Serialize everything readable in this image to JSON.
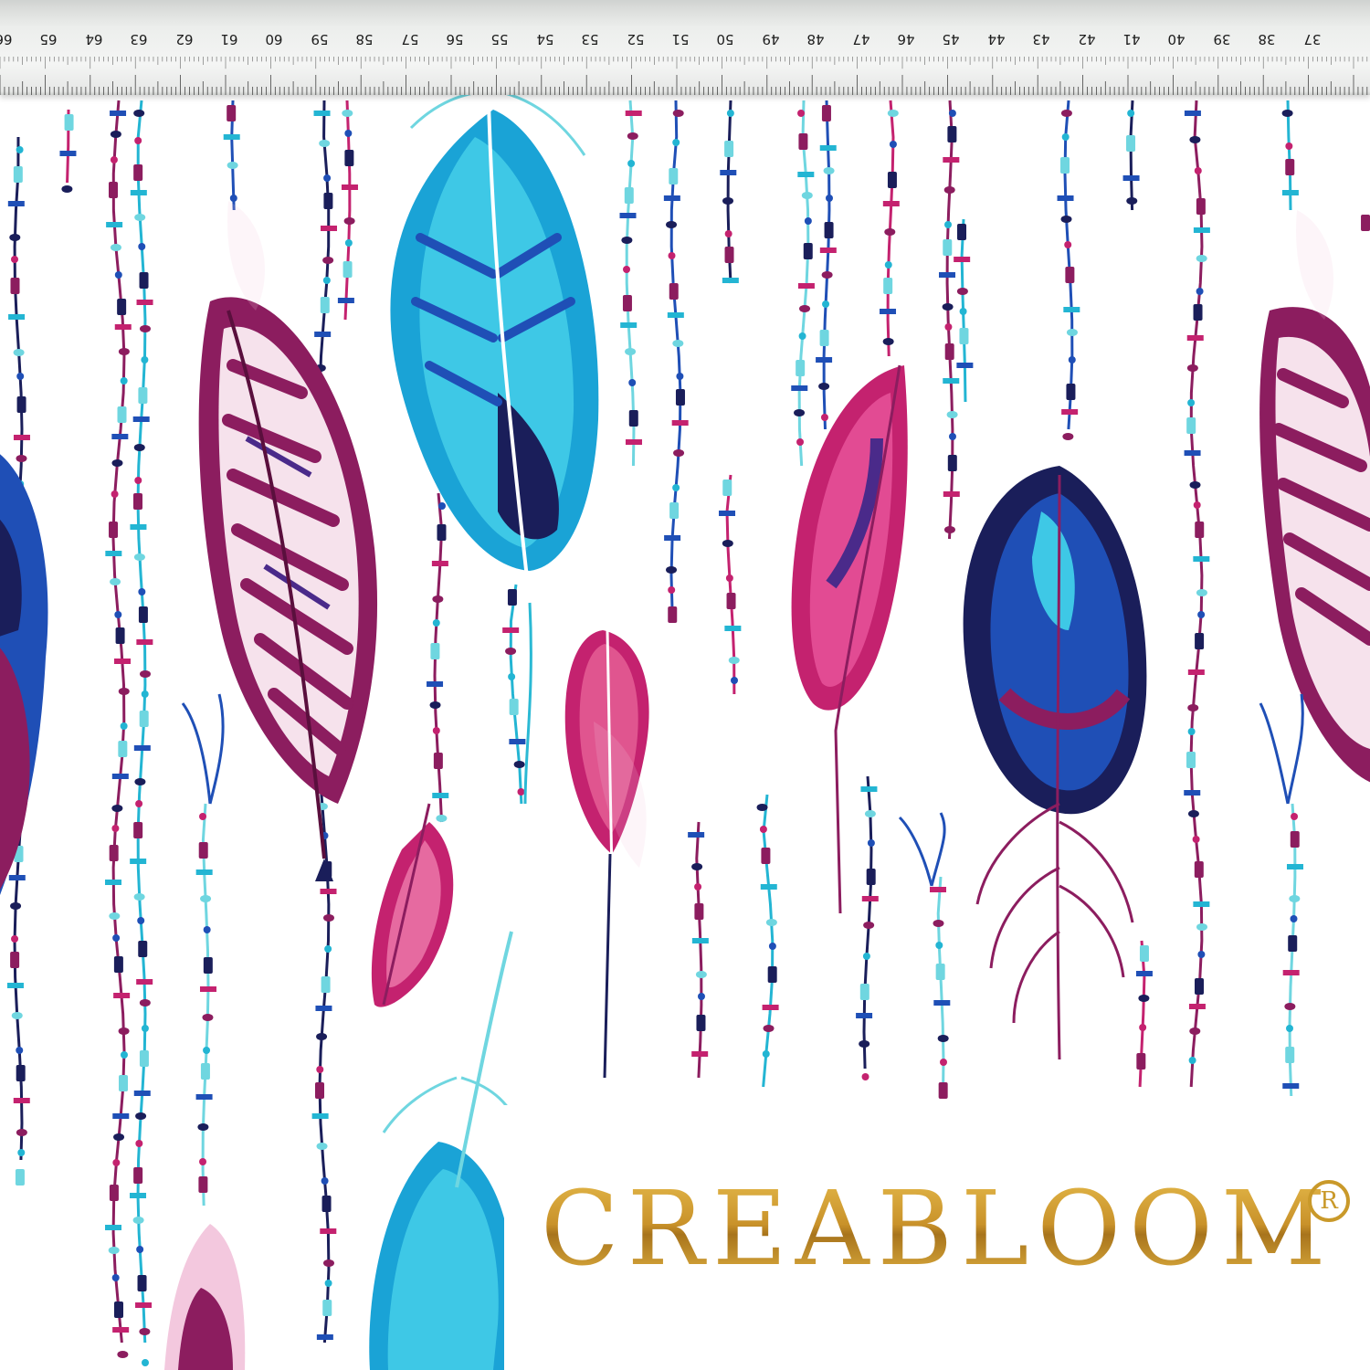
{
  "image": {
    "subject": "fabric-swatch",
    "palette": {
      "background": "#ffffff",
      "turquoise": "#23b5d3",
      "aqua": "#6fd6e0",
      "royal_blue": "#1f4fb6",
      "navy": "#1a1e5a",
      "magenta": "#c4226f",
      "plum": "#8c1d5f",
      "pink_light": "#f3c8de",
      "gold": "#c9992a"
    }
  },
  "ruler": {
    "numbers": [
      "66",
      "65",
      "64",
      "63",
      "62",
      "61",
      "60",
      "59",
      "58",
      "57",
      "56",
      "55",
      "54",
      "53",
      "52",
      "51",
      "50",
      "49",
      "48",
      "47",
      "46",
      "45",
      "44",
      "43",
      "42",
      "41",
      "40",
      "39",
      "38",
      "37"
    ]
  },
  "brand": {
    "name": "CREABLOOM",
    "mark": "R"
  }
}
